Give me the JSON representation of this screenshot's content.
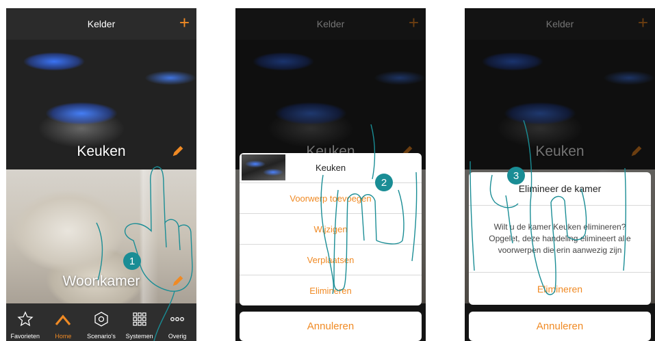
{
  "accent_color": "#f08a24",
  "step_color": "#1a8d95",
  "header": {
    "title": "Kelder",
    "add_label": "+"
  },
  "rooms": [
    {
      "label": "Keuken"
    },
    {
      "label": "Woonkamer"
    }
  ],
  "tabbar": [
    {
      "label": "Favorieten",
      "icon": "star-icon",
      "active": false
    },
    {
      "label": "Home",
      "icon": "home-icon",
      "active": true
    },
    {
      "label": "Scenario's",
      "icon": "scenario-icon",
      "active": false
    },
    {
      "label": "Systemen",
      "icon": "grid-icon",
      "active": false
    },
    {
      "label": "Overig",
      "icon": "more-icon",
      "active": false
    }
  ],
  "action_sheet": {
    "title": "Keuken",
    "items": [
      "Voorwerp toevoegen",
      "Wijzigen",
      "Verplaatsen",
      "Elimineren"
    ],
    "cancel": "Annuleren"
  },
  "confirm": {
    "title": "Elimineer de kamer",
    "message": "Wilt u de kamer Keuken elimineren?\nOpgelet, deze handeling elimineert alle\nvoorwerpen die erin aanwezig zijn",
    "confirm_label": "Elimineren",
    "cancel": "Annuleren"
  },
  "steps": [
    "1",
    "2",
    "3"
  ]
}
